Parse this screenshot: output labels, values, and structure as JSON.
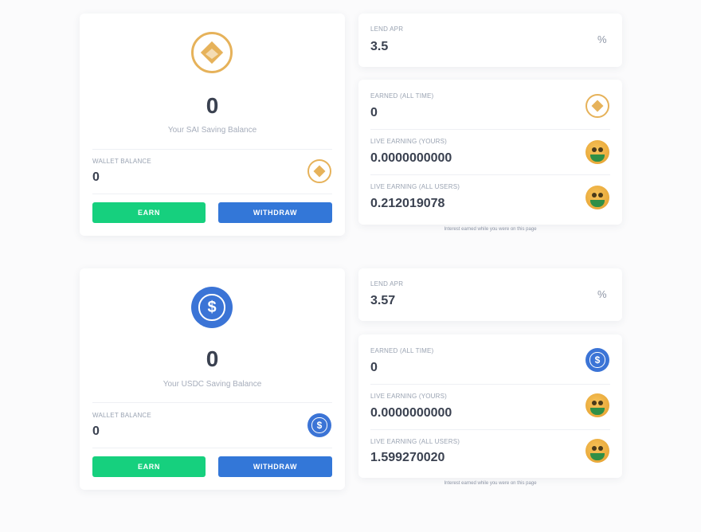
{
  "sai": {
    "balance": "0",
    "balance_caption": "Your SAI Saving Balance",
    "wallet_label": "WALLET BALANCE",
    "wallet_value": "0",
    "earn_label": "EARN",
    "withdraw_label": "WITHDRAW",
    "apr_label": "LEND APR",
    "apr_value": "3.5",
    "apr_unit": "%",
    "earned_label": "EARNED (ALL TIME)",
    "earned_value": "0",
    "live_yours_label": "LIVE EARNING (YOURS)",
    "live_yours_value": "0.0000000000",
    "live_all_label": "LIVE EARNING (ALL USERS)",
    "live_all_value": "0.212019078",
    "note": "Interest earned while you were on this page"
  },
  "usdc": {
    "balance": "0",
    "balance_caption": "Your USDC Saving Balance",
    "wallet_label": "WALLET BALANCE",
    "wallet_value": "0",
    "earn_label": "EARN",
    "withdraw_label": "WITHDRAW",
    "apr_label": "LEND APR",
    "apr_value": "3.57",
    "apr_unit": "%",
    "earned_label": "EARNED (ALL TIME)",
    "earned_value": "0",
    "live_yours_label": "LIVE EARNING (YOURS)",
    "live_yours_value": "0.0000000000",
    "live_all_label": "LIVE EARNING (ALL USERS)",
    "live_all_value": "1.599270020",
    "note": "Interest earned while you were on this page"
  },
  "colors": {
    "earn": "#16d07e",
    "withdraw": "#3377d8",
    "sai_gold": "#e6b25a",
    "usdc_blue": "#3b74d6"
  },
  "icons": {
    "sai": "sai-coin-icon",
    "usdc": "usdc-coin-icon",
    "money_face": "money-mouth-face-icon",
    "percent": "percent-icon"
  }
}
